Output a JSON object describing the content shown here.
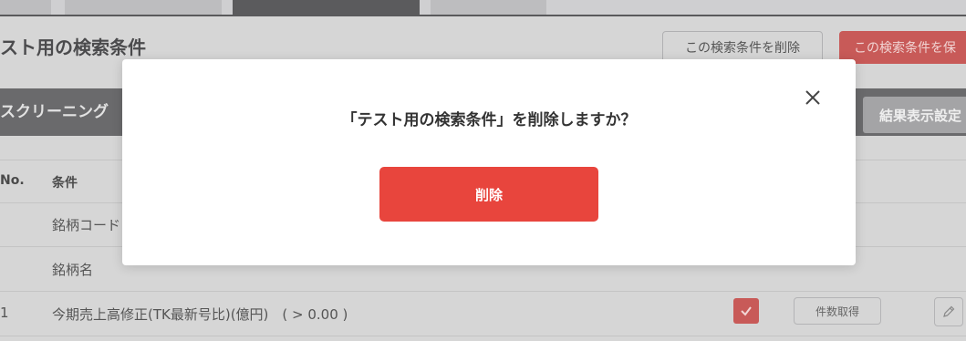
{
  "header": {
    "title": "スト用の検索条件",
    "delete_button": "この検索条件を削除",
    "save_button": "この検索条件を保"
  },
  "section": {
    "title": "スクリーニング",
    "result_settings_button": "結果表示設定"
  },
  "table": {
    "columns": [
      "No.",
      "条件"
    ],
    "rows": [
      {
        "no": "",
        "condition": "銘柄コード"
      },
      {
        "no": "",
        "condition": "銘柄名"
      },
      {
        "no": "1",
        "condition": "今期売上高修正(TK最新号比)(億円)　( > 0.00 )",
        "count_button": "件数取得"
      }
    ]
  },
  "modal": {
    "message": "「テスト用の検索条件」を削除しますか？",
    "delete_button": "削除"
  },
  "colors": {
    "accent_red": "#e8453d",
    "overlay_gray": "#d6d6d6"
  }
}
